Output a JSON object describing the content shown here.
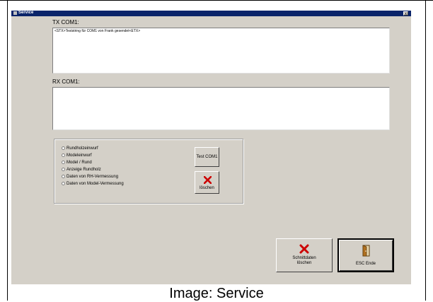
{
  "window": {
    "title": "Service",
    "close_glyph": "x"
  },
  "tx": {
    "label": "TX COM1:",
    "value": "<STX>Teststring für COM1 von Frank gesendet<ETX>"
  },
  "rx": {
    "label": "RX COM1:",
    "value": ""
  },
  "radio_options": [
    {
      "label": "Rundholzeinwurf"
    },
    {
      "label": "Modeleinwurf"
    },
    {
      "label": "Model / Rund"
    },
    {
      "label": "Anzeige Rundholz"
    },
    {
      "label": "Daten von RH-Vermessung"
    },
    {
      "label": "Daten von Model-Vermessung"
    }
  ],
  "buttons": {
    "test_com1": "Test COM1",
    "loeschen": "löschen",
    "schnittdaten_line1": "Schnittdaten",
    "schnittdaten_line2": "löschen",
    "esc_ende": "ESC Ende"
  },
  "icons": {
    "delete_color": "#cc0000",
    "door_color": "#b07020"
  },
  "caption": "Image: Service"
}
